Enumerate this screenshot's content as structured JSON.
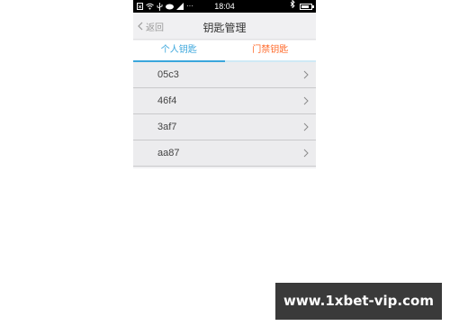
{
  "status_bar": {
    "dots": "···",
    "time": "18:04"
  },
  "navbar": {
    "back_label": "返回",
    "title": "钥匙管理"
  },
  "tabs": [
    {
      "label": "个人钥匙",
      "selected": true
    },
    {
      "label": "门禁钥匙",
      "selected": false
    }
  ],
  "keys": [
    {
      "label": "05c3"
    },
    {
      "label": "46f4"
    },
    {
      "label": "3af7"
    },
    {
      "label": "aa87"
    }
  ],
  "watermark": "www.1xbet-vip.com",
  "colors": {
    "accent_blue": "#3aa6dc",
    "accent_orange": "#ff6a2a",
    "status_bar": "#000000",
    "list_bg": "#ececee"
  }
}
